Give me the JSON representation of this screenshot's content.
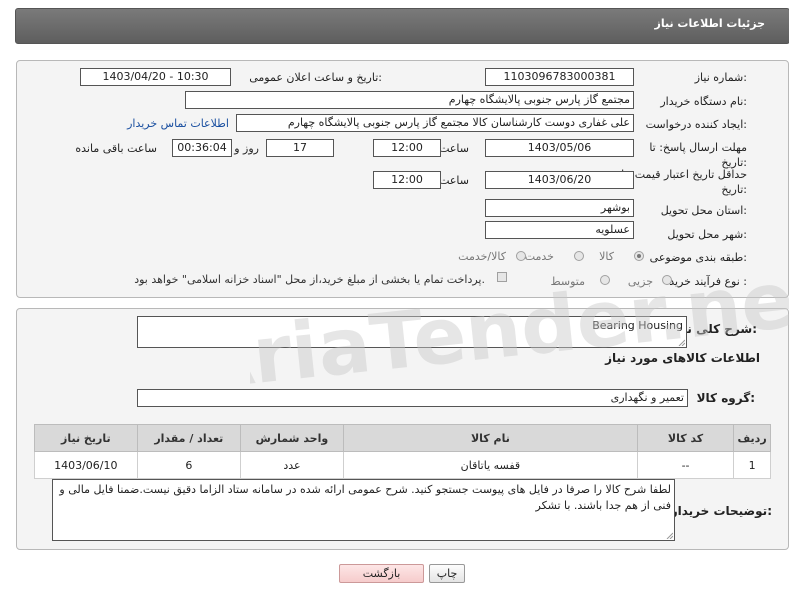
{
  "header": {
    "title": "جزئیات اطلاعات نیاز"
  },
  "form": {
    "need_number": {
      "label": "شماره نیاز:",
      "value": "1103096783000381"
    },
    "announce_datetime": {
      "label": "تاریخ و ساعت اعلان عمومی:",
      "value": "1403/04/20 - 10:30"
    },
    "buyer_org": {
      "label": "نام دستگاه خریدار:",
      "value": "مجتمع گاز پارس جنوبی  پالایشگاه چهارم"
    },
    "requester": {
      "label": "ایجاد کننده درخواست:",
      "value": "علی غفاری دوست کارشناسان کالا مجتمع گاز پارس جنوبی  پالایشگاه چهارم",
      "contact_link": "اطلاعات تماس خریدار"
    },
    "reply_deadline": {
      "label": "مهلت ارسال پاسخ: تا تاریخ:",
      "date": "1403/05/06",
      "time_label": "ساعت",
      "time": "12:00",
      "days": "17",
      "days_label": "روز و",
      "remaining": "00:36:04",
      "remaining_label": "ساعت باقی مانده"
    },
    "price_validity": {
      "label": "حداقل تاریخ اعتبار قیمت: تا تاریخ:",
      "date": "1403/06/20",
      "time_label": "ساعت",
      "time": "12:00"
    },
    "province": {
      "label": "استان محل تحویل:",
      "value": "بوشهر"
    },
    "city": {
      "label": "شهر محل تحویل:",
      "value": "عسلویه"
    },
    "category": {
      "label": "طبقه بندی موضوعی:",
      "options": [
        "کالا",
        "خدمت",
        "کالا/خدمت"
      ],
      "selected": "کالا"
    },
    "process_type": {
      "label": "نوع فرآیند خرید :",
      "options": [
        "جزیی",
        "متوسط"
      ],
      "note": "پرداخت تمام یا بخشی از مبلغ خرید،از محل \"اسناد خزانه اسلامی\" خواهد بود."
    }
  },
  "summary": {
    "label": "شرح کلی نیاز:",
    "value": "Bearing Housing"
  },
  "goods_section": {
    "title": "اطلاعات کالاهای مورد نیاز",
    "group_label": "گروه کالا:",
    "group_value": "تعمیر و نگهداری",
    "table": {
      "headers": [
        "ردیف",
        "کد کالا",
        "نام کالا",
        "واحد شمارش",
        "تعداد / مقدار",
        "تاریخ نیاز"
      ],
      "rows": [
        {
          "row": "1",
          "code": "--",
          "name": "قفسه یاتاقان",
          "unit": "عدد",
          "qty": "6",
          "date": "1403/06/10"
        }
      ]
    },
    "buyer_notes_label": "توضیحات خریدار:",
    "buyer_notes": "لطفا شرح کالا را صرفا در فایل های پیوست جستجو کنید. شرح عمومی ارائه شده در سامانه ستاد الزاما دقیق نیست.ضمنا فایل مالی و فنی از هم جدا باشند. با تشکر"
  },
  "buttons": {
    "print": "چاپ",
    "back": "بازگشت"
  },
  "watermark": "AriaTender.neT"
}
